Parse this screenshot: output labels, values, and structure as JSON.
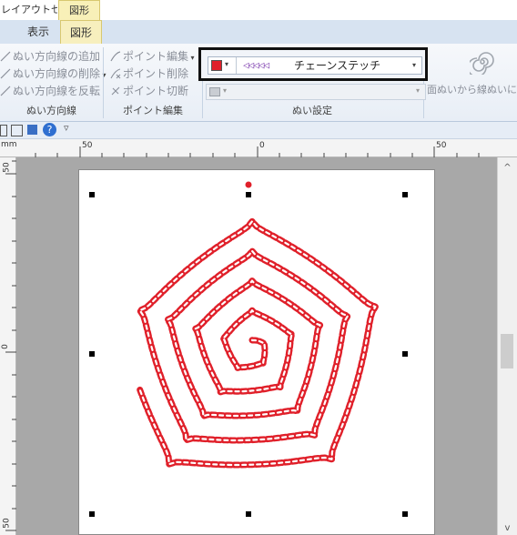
{
  "tabs": {
    "context_left": "レイアウトセ...",
    "context_right": "図形",
    "view": "表示",
    "shape": "図形"
  },
  "ribbon": {
    "sew_direction": {
      "items": [
        "ぬい方向線の追加",
        "ぬい方向線の削除",
        "ぬい方向線を反転"
      ],
      "label": "ぬい方向線"
    },
    "point_edit": {
      "items": [
        "ポイント編集",
        "ポイント削除",
        "ポイント切断"
      ],
      "label": "ポイント編集"
    },
    "sew_settings": {
      "stitch_pattern": "◁◁◁◁◁",
      "stitch_name": "チェーンステッチ",
      "label": "ぬい設定"
    },
    "partial": {
      "text": "面ぬいから線ぬいに"
    }
  },
  "ruler": {
    "unit": "mm",
    "top_labels": [
      "50",
      "0",
      "50"
    ],
    "left_labels": [
      "50",
      "0",
      "50"
    ]
  },
  "colors": {
    "thread": "#e0202a",
    "stitch_icon": "#7f3fb0",
    "ribbon_bg": "#e8eef6",
    "canvas_bg": "#a8a8a8"
  },
  "icons": {
    "stitch_color": "red-square-icon",
    "spiral": "spiral-icon",
    "help": "help-icon"
  }
}
